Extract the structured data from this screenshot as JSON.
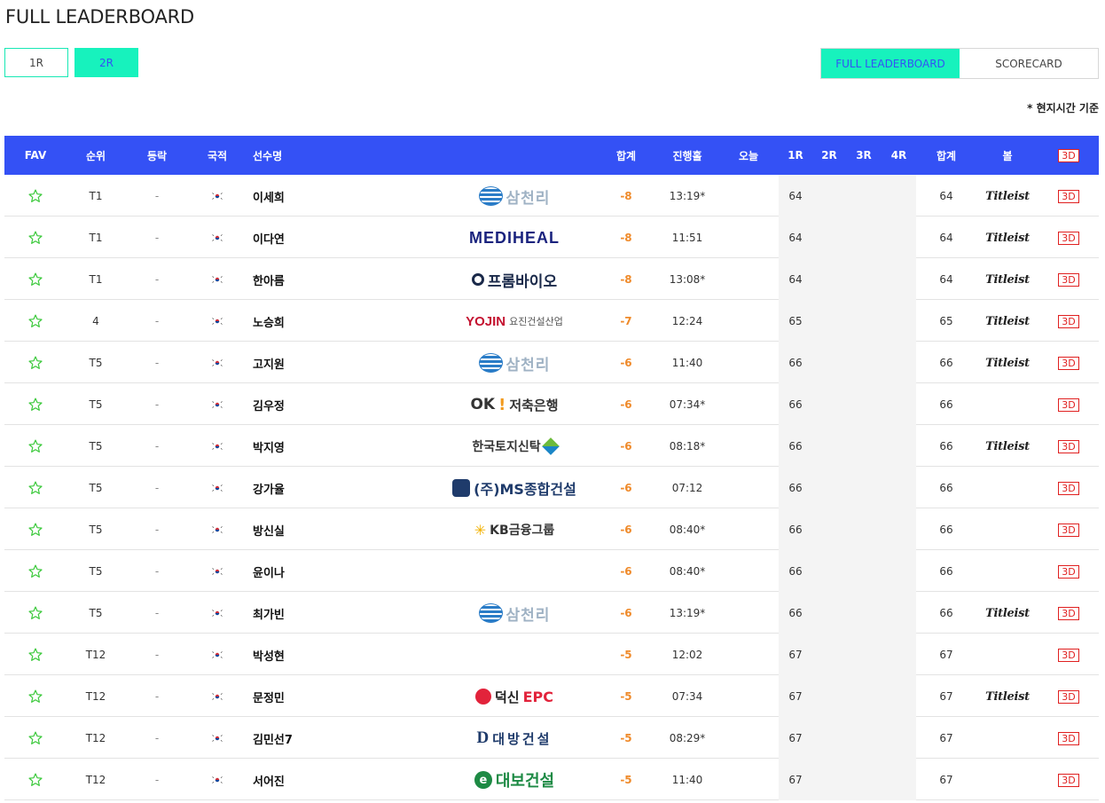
{
  "page_title": "FULL LEADERBOARD",
  "round_tabs": [
    {
      "label": "1R",
      "active": false
    },
    {
      "label": "2R",
      "active": true
    }
  ],
  "view_tabs": [
    {
      "label": "FULL LEADERBOARD",
      "active": true
    },
    {
      "label": "SCORECARD",
      "active": false
    }
  ],
  "time_note": "* 현지시간 기준",
  "colors": {
    "header_bg": "#3451f5",
    "accent": "#17f2bd",
    "under_par": "#ef8a2a",
    "badge_red": "#e02020",
    "star_green": "#3cc93c"
  },
  "columns": {
    "fav": "FAV",
    "rank": "순위",
    "move": "등락",
    "nation": "국적",
    "name": "선수명",
    "total": "합계",
    "thru": "진행홀",
    "today": "오늘",
    "r1": "1R",
    "r2": "2R",
    "r3": "3R",
    "r4": "4R",
    "sum": "합계",
    "ball": "볼",
    "view3d": "3D"
  },
  "rows": [
    {
      "rank": "T1",
      "move": "-",
      "name": "이세희",
      "sponsor": "삼천리",
      "sponsor_type": "samchully",
      "total": "-8",
      "thru": "13:19*",
      "today": "",
      "r1": "64",
      "r2": "",
      "r3": "",
      "r4": "",
      "sum": "64",
      "ball": "Titleist",
      "view3d": "3D"
    },
    {
      "rank": "T1",
      "move": "-",
      "name": "이다연",
      "sponsor": "MEDIHEAL",
      "sponsor_type": "mediheal",
      "total": "-8",
      "thru": "11:51",
      "today": "",
      "r1": "64",
      "r2": "",
      "r3": "",
      "r4": "",
      "sum": "64",
      "ball": "Titleist",
      "view3d": "3D"
    },
    {
      "rank": "T1",
      "move": "-",
      "name": "한아름",
      "sponsor": "프롬바이오",
      "sponsor_type": "promo",
      "total": "-8",
      "thru": "13:08*",
      "today": "",
      "r1": "64",
      "r2": "",
      "r3": "",
      "r4": "",
      "sum": "64",
      "ball": "Titleist",
      "view3d": "3D"
    },
    {
      "rank": "4",
      "move": "-",
      "name": "노승희",
      "sponsor": "YOJIN",
      "sponsor_sub": "요진건설산업",
      "sponsor_type": "yojin",
      "total": "-7",
      "thru": "12:24",
      "today": "",
      "r1": "65",
      "r2": "",
      "r3": "",
      "r4": "",
      "sum": "65",
      "ball": "Titleist",
      "view3d": "3D"
    },
    {
      "rank": "T5",
      "move": "-",
      "name": "고지원",
      "sponsor": "삼천리",
      "sponsor_type": "samchully",
      "total": "-6",
      "thru": "11:40",
      "today": "",
      "r1": "66",
      "r2": "",
      "r3": "",
      "r4": "",
      "sum": "66",
      "ball": "Titleist",
      "view3d": "3D"
    },
    {
      "rank": "T5",
      "move": "-",
      "name": "김우정",
      "sponsor": "OK",
      "sponsor_sub": "저축은행",
      "sponsor_type": "ok",
      "total": "-6",
      "thru": "07:34*",
      "today": "",
      "r1": "66",
      "r2": "",
      "r3": "",
      "r4": "",
      "sum": "66",
      "ball": "",
      "view3d": "3D"
    },
    {
      "rank": "T5",
      "move": "-",
      "name": "박지영",
      "sponsor": "한국토지신탁",
      "sponsor_type": "koreatrust",
      "total": "-6",
      "thru": "08:18*",
      "today": "",
      "r1": "66",
      "r2": "",
      "r3": "",
      "r4": "",
      "sum": "66",
      "ball": "Titleist",
      "view3d": "3D"
    },
    {
      "rank": "T5",
      "move": "-",
      "name": "강가율",
      "sponsor": "(주)MS종합건설",
      "sponsor_type": "ms",
      "total": "-6",
      "thru": "07:12",
      "today": "",
      "r1": "66",
      "r2": "",
      "r3": "",
      "r4": "",
      "sum": "66",
      "ball": "",
      "view3d": "3D"
    },
    {
      "rank": "T5",
      "move": "-",
      "name": "방신실",
      "sponsor": "KB금융그룹",
      "sponsor_type": "kb",
      "total": "-6",
      "thru": "08:40*",
      "today": "",
      "r1": "66",
      "r2": "",
      "r3": "",
      "r4": "",
      "sum": "66",
      "ball": "",
      "view3d": "3D"
    },
    {
      "rank": "T5",
      "move": "-",
      "name": "윤이나",
      "sponsor": "",
      "sponsor_type": "none",
      "total": "-6",
      "thru": "08:40*",
      "today": "",
      "r1": "66",
      "r2": "",
      "r3": "",
      "r4": "",
      "sum": "66",
      "ball": "",
      "view3d": "3D"
    },
    {
      "rank": "T5",
      "move": "-",
      "name": "최가빈",
      "sponsor": "삼천리",
      "sponsor_type": "samchully",
      "total": "-6",
      "thru": "13:19*",
      "today": "",
      "r1": "66",
      "r2": "",
      "r3": "",
      "r4": "",
      "sum": "66",
      "ball": "Titleist",
      "view3d": "3D"
    },
    {
      "rank": "T12",
      "move": "-",
      "name": "박성현",
      "sponsor": "",
      "sponsor_type": "none",
      "total": "-5",
      "thru": "12:02",
      "today": "",
      "r1": "67",
      "r2": "",
      "r3": "",
      "r4": "",
      "sum": "67",
      "ball": "",
      "view3d": "3D"
    },
    {
      "rank": "T12",
      "move": "-",
      "name": "문정민",
      "sponsor": "덕신",
      "sponsor_sub": "EPC",
      "sponsor_type": "duckshin",
      "total": "-5",
      "thru": "07:34",
      "today": "",
      "r1": "67",
      "r2": "",
      "r3": "",
      "r4": "",
      "sum": "67",
      "ball": "Titleist",
      "view3d": "3D"
    },
    {
      "rank": "T12",
      "move": "-",
      "name": "김민선7",
      "sponsor": "대방건설",
      "sponsor_type": "daebang",
      "total": "-5",
      "thru": "08:29*",
      "today": "",
      "r1": "67",
      "r2": "",
      "r3": "",
      "r4": "",
      "sum": "67",
      "ball": "",
      "view3d": "3D"
    },
    {
      "rank": "T12",
      "move": "-",
      "name": "서어진",
      "sponsor": "대보건설",
      "sponsor_type": "daebo",
      "total": "-5",
      "thru": "11:40",
      "today": "",
      "r1": "67",
      "r2": "",
      "r3": "",
      "r4": "",
      "sum": "67",
      "ball": "",
      "view3d": "3D"
    }
  ]
}
